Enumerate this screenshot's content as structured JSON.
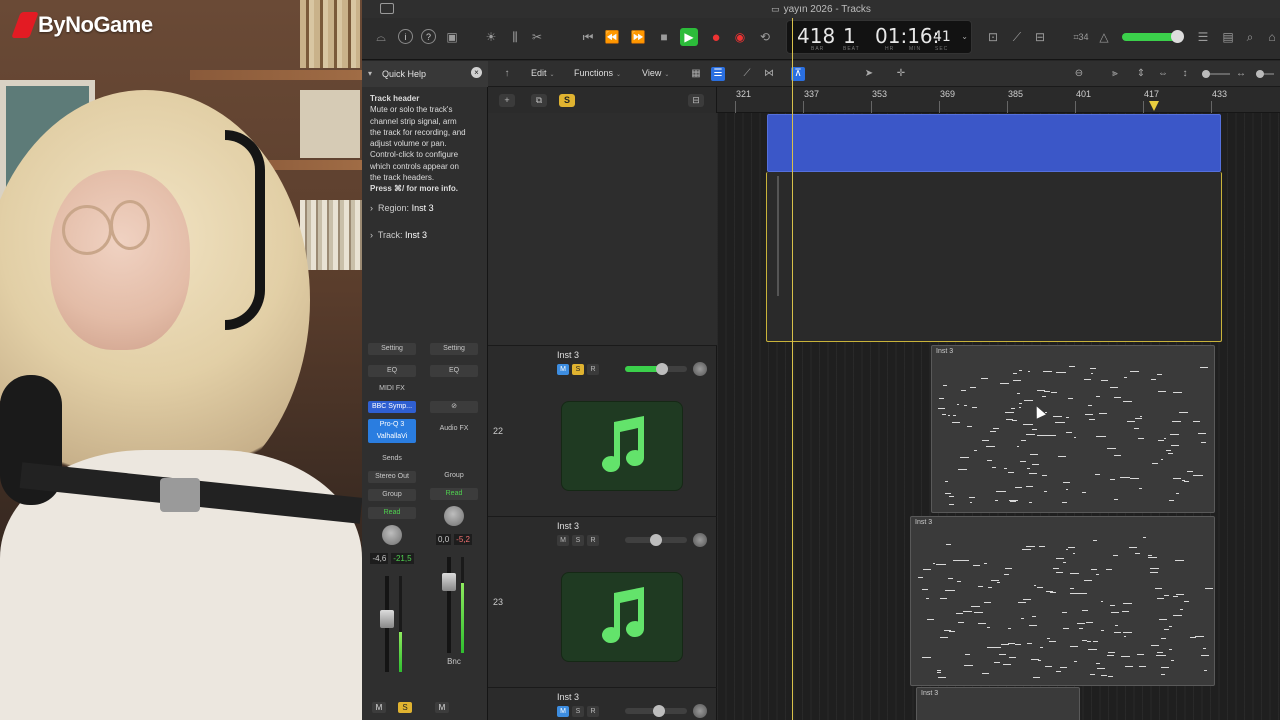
{
  "webcam": {
    "logo_text": "ByNoGame"
  },
  "window": {
    "title": "yayın 2026 - Tracks"
  },
  "toolbar": {
    "lcd": {
      "bar": "418",
      "beat": "1",
      "time_main": "01:16:",
      "time_small": "41",
      "bar_label": "BAR",
      "beat_label": "BEAT",
      "hr_label": "HR",
      "min_label": "MIN",
      "sec_label": "SEC"
    },
    "key_label": "⌗34",
    "play_color": "#2cbc3a",
    "record_color": "#e03333"
  },
  "inspector": {
    "quick_help": {
      "title": "Quick Help",
      "heading": "Track header",
      "lines": [
        "Mute or solo the track's",
        "channel strip signal, arm",
        "the track for recording, and",
        "adjust volume or pan.",
        "Control-click to configure",
        "which controls appear on",
        "the track headers."
      ],
      "more": "Press ⌘/ for more info."
    },
    "region": {
      "label": "Region:",
      "value": "Inst 3"
    },
    "track": {
      "label": "Track:",
      "value": "Inst 3"
    },
    "strip_left": {
      "setting": "Setting",
      "eq": "EQ",
      "midi_fx": "MIDI FX",
      "instrument": "BBC Symp...",
      "plugin1": "Pro-Q 3",
      "plugin2": "ValhallaVi",
      "sends": "Sends",
      "output": "Stereo Out",
      "group": "Group",
      "automation": "Read",
      "val1": "-4,6",
      "val2": "-21,5",
      "mute": "M",
      "solo": "S"
    },
    "strip_right": {
      "setting": "Setting",
      "eq": "EQ",
      "audio_fx": "Audio FX",
      "group": "Group",
      "automation": "Read",
      "val1": "0,0",
      "val2": "-5,2",
      "mute": "M",
      "bounce": "Bnc"
    }
  },
  "tracks_menu": {
    "edit": "Edit",
    "functions": "Functions",
    "view": "View"
  },
  "header_controls": {
    "add": "+",
    "solo_global": "S"
  },
  "ruler": {
    "bars": [
      "321",
      "337",
      "353",
      "369",
      "385",
      "401",
      "417",
      "433"
    ]
  },
  "tracks": [
    {
      "number": "22",
      "name": "Inst 3",
      "mute": "M",
      "solo": "S",
      "record": "R",
      "volume": 0.6
    },
    {
      "number": "23",
      "name": "Inst 3",
      "mute": "M",
      "solo": "S",
      "record": "R",
      "volume": 0.5
    },
    {
      "number": "",
      "name": "Inst 3",
      "mute": "M",
      "solo": "S",
      "record": "R",
      "volume": 0.55
    }
  ],
  "regions": [
    {
      "name": "Inst 3"
    },
    {
      "name": "Inst 3"
    },
    {
      "name": "Inst 3"
    }
  ]
}
